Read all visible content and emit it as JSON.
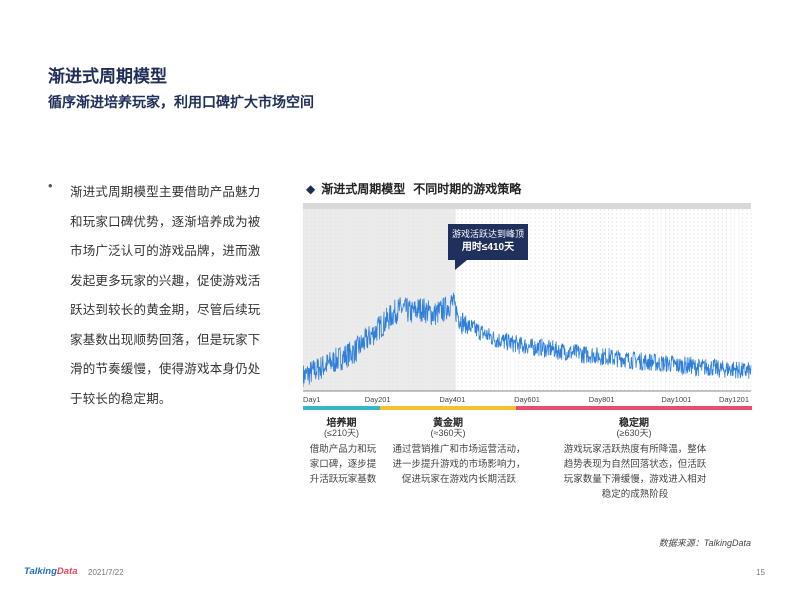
{
  "header": {
    "title": "渐进式周期模型",
    "subtitle": "循序渐进培养玩家，利用口碑扩大市场空间"
  },
  "bullet": {
    "dot": "•",
    "text": "渐进式周期模型主要借助产品魅力和玩家口碑优势，逐渐培养成为被市场广泛认可的游戏品牌，进而激发起更多玩家的兴趣，促使游戏活跃达到较长的黄金期，尽管后续玩家基数出现顺势回落，但是玩家下滑的节奏缓慢，使得游戏本身仍处于较长的稳定期。"
  },
  "chart_title": {
    "marker": "◆",
    "part1": "渐进式周期模型",
    "part2": "不同时期的游戏策略"
  },
  "callout": {
    "line1": "游戏活跃达到峰顶",
    "line2": "用时≤410天"
  },
  "colors": {
    "line": "#2f7ed8",
    "navy": "#1f2d57",
    "phase_growth": "#38b6c9",
    "phase_golden": "#f3c233",
    "phase_stable": "#e6506a"
  },
  "phases": [
    {
      "name": "培养期",
      "duration": "(≤210天)",
      "desc": "借助产品力和玩家口碑，逐步提升活跃玩家基数"
    },
    {
      "name": "黄金期",
      "duration": "(≈360天)",
      "desc": "通过营销推广和市场运营活动，进一步提升游戏的市场影响力，促进玩家在游戏内长期活跃"
    },
    {
      "name": "稳定期",
      "duration": "(≥630天)",
      "desc": "游戏玩家活跃热度有所降温，整体趋势表现为自然回落状态，但活跃玩家数量下滑缓慢，游戏进入相对稳定的成熟阶段"
    }
  ],
  "chart_data": {
    "type": "line",
    "x_tick_labels": [
      "Day1",
      "Day201",
      "Day401",
      "Day601",
      "Day801",
      "Day1001",
      "Day1201"
    ],
    "xlim": [
      1,
      1201
    ],
    "highlight_range": [
      1,
      410
    ],
    "ylim": [
      0,
      1
    ],
    "grid": true,
    "series": [
      {
        "values_day_step": 10,
        "values": [
          0.08,
          0.09,
          0.1,
          0.11,
          0.12,
          0.13,
          0.14,
          0.15,
          0.16,
          0.17,
          0.18,
          0.19,
          0.2,
          0.21,
          0.22,
          0.24,
          0.26,
          0.28,
          0.3,
          0.32,
          0.34,
          0.36,
          0.38,
          0.4,
          0.42,
          0.44,
          0.45,
          0.45,
          0.44,
          0.43,
          0.44,
          0.45,
          0.45,
          0.44,
          0.43,
          0.42,
          0.43,
          0.44,
          0.45,
          0.47,
          0.49,
          0.44,
          0.4,
          0.37,
          0.36,
          0.35,
          0.34,
          0.33,
          0.32,
          0.31,
          0.3,
          0.29,
          0.28,
          0.28,
          0.27,
          0.27,
          0.26,
          0.26,
          0.25,
          0.25,
          0.25,
          0.24,
          0.24,
          0.24,
          0.24,
          0.23,
          0.23,
          0.23,
          0.22,
          0.22,
          0.22,
          0.21,
          0.21,
          0.21,
          0.21,
          0.2,
          0.2,
          0.2,
          0.2,
          0.19,
          0.19,
          0.19,
          0.19,
          0.18,
          0.18,
          0.18,
          0.18,
          0.17,
          0.17,
          0.17,
          0.17,
          0.16,
          0.16,
          0.16,
          0.16,
          0.15,
          0.15,
          0.15,
          0.15,
          0.15,
          0.14,
          0.14,
          0.14,
          0.14,
          0.14,
          0.13,
          0.13,
          0.13,
          0.13,
          0.13,
          0.13,
          0.12,
          0.12,
          0.12,
          0.12,
          0.12,
          0.12,
          0.11,
          0.11,
          0.11,
          0.11
        ]
      }
    ]
  },
  "footer": {
    "source": "数据来源：TalkingData",
    "logo_a": "Talking",
    "logo_b": "Data",
    "date": "2021/7/22",
    "page": "15"
  }
}
